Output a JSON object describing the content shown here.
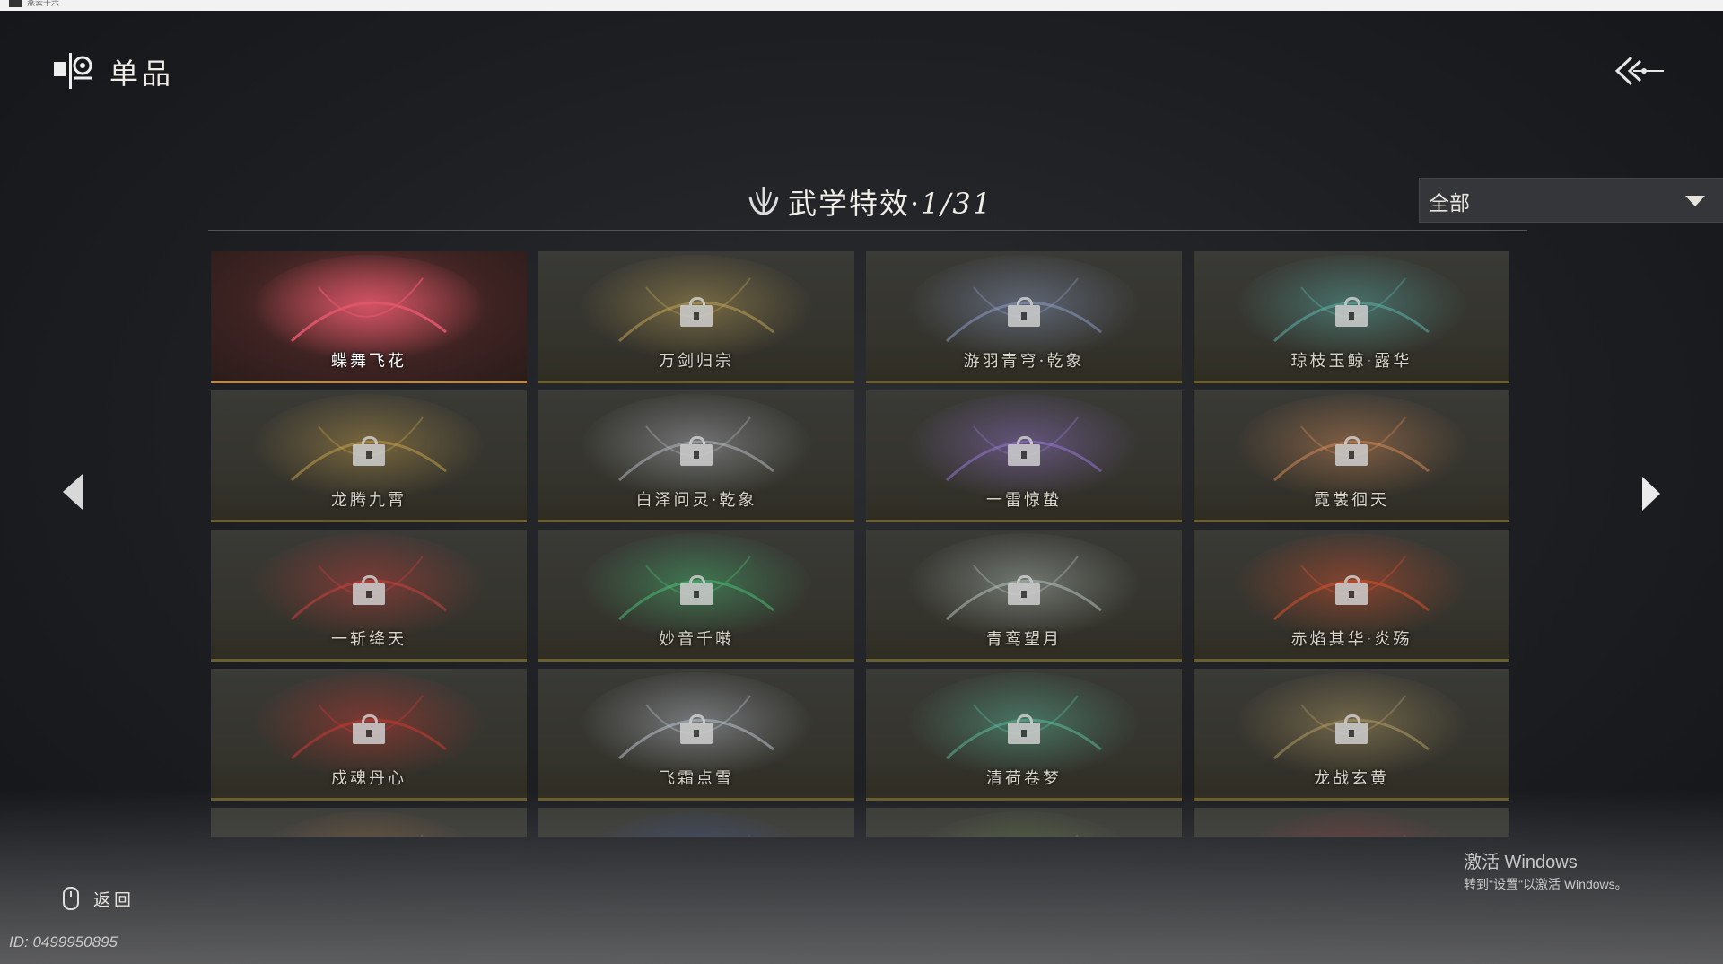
{
  "window": {
    "title": "燕云十六"
  },
  "header": {
    "title": "单品"
  },
  "section": {
    "title": "武学特效·",
    "count": "1/31"
  },
  "filter": {
    "value": "全部"
  },
  "items": [
    {
      "name": "蝶舞飞花",
      "selected": true,
      "locked": false,
      "color": "#e0566a"
    },
    {
      "name": "万剑归宗",
      "selected": false,
      "locked": true,
      "color": "#c4a85a"
    },
    {
      "name": "游羽青穹·乾象",
      "selected": false,
      "locked": true,
      "color": "#8fa0c8"
    },
    {
      "name": "琼枝玉鲸·露华",
      "selected": false,
      "locked": true,
      "color": "#5fb7b0"
    },
    {
      "name": "龙腾九霄",
      "selected": false,
      "locked": true,
      "color": "#c9a34e"
    },
    {
      "name": "白泽问灵·乾象",
      "selected": false,
      "locked": true,
      "color": "#b8bcc4"
    },
    {
      "name": "一雷惊蛰",
      "selected": false,
      "locked": true,
      "color": "#9a7ad8"
    },
    {
      "name": "霓裳徊天",
      "selected": false,
      "locked": true,
      "color": "#d88e5a"
    },
    {
      "name": "一斩绛天",
      "selected": false,
      "locked": true,
      "color": "#d0423e"
    },
    {
      "name": "妙音千啭",
      "selected": false,
      "locked": true,
      "color": "#4cc27a"
    },
    {
      "name": "青鸾望月",
      "selected": false,
      "locked": true,
      "color": "#b9c7c0"
    },
    {
      "name": "赤焰其华·炎殇",
      "selected": false,
      "locked": true,
      "color": "#e2542e"
    },
    {
      "name": "戍魂丹心",
      "selected": false,
      "locked": true,
      "color": "#d23a34"
    },
    {
      "name": "飞霜点雪",
      "selected": false,
      "locked": true,
      "color": "#c0c8d4"
    },
    {
      "name": "清荷卷梦",
      "selected": false,
      "locked": true,
      "color": "#5dbfa0"
    },
    {
      "name": "龙战玄黄",
      "selected": false,
      "locked": true,
      "color": "#b8a066"
    },
    {
      "name": "",
      "selected": false,
      "locked": false,
      "color": "#c07a3a"
    },
    {
      "name": "",
      "selected": false,
      "locked": false,
      "color": "#3a5ab8"
    },
    {
      "name": "",
      "selected": false,
      "locked": false,
      "color": "#7aa048"
    },
    {
      "name": "",
      "selected": false,
      "locked": false,
      "color": "#b83a3a"
    }
  ],
  "footer": {
    "back_label": "返回",
    "player_id": "ID: 0499950895"
  },
  "watermark": {
    "title": "激活 Windows",
    "subtitle": "转到\"设置\"以激活 Windows。"
  }
}
